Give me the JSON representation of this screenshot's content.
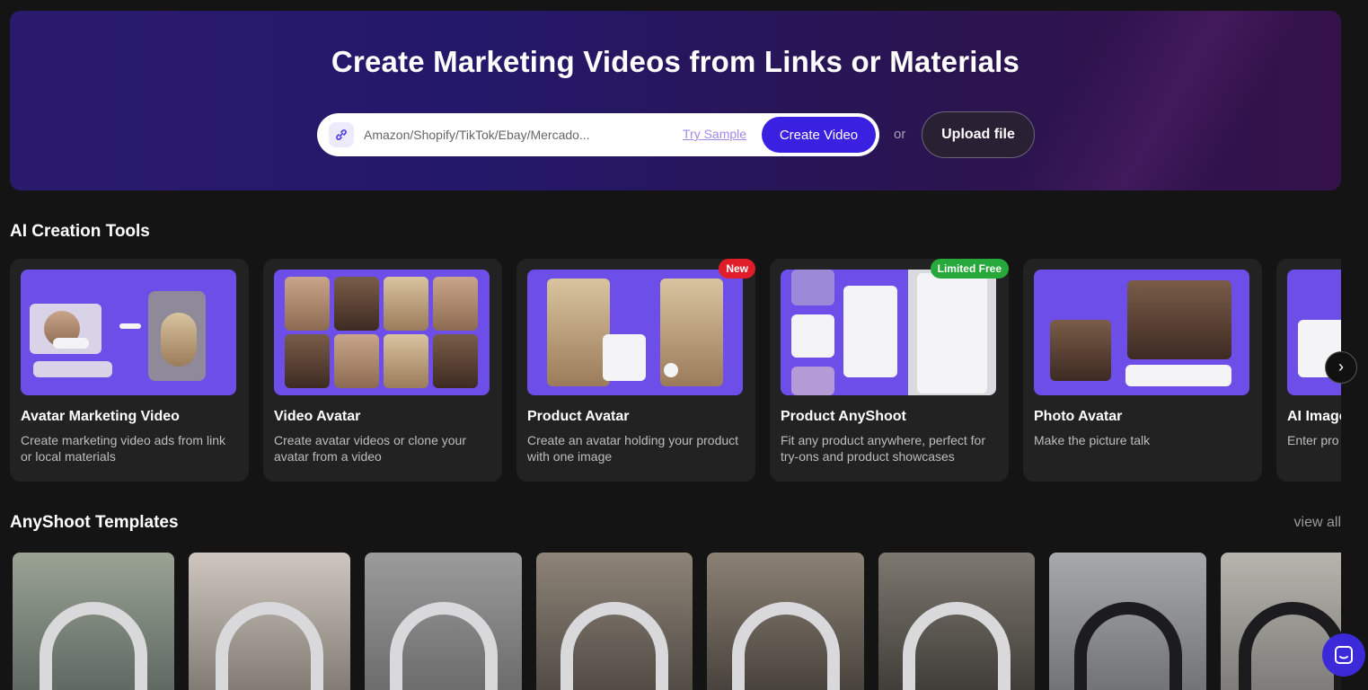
{
  "hero": {
    "title": "Create Marketing Videos from Links or Materials",
    "search_placeholder": "Amazon/Shopify/TikTok/Ebay/Mercado...",
    "try_sample": "Try Sample",
    "create_button": "Create Video",
    "or_label": "or",
    "upload_button": "Upload file",
    "link_icon": "link-icon"
  },
  "tools_section": {
    "title": "AI Creation Tools",
    "cards": [
      {
        "name": "Avatar Marketing Video",
        "desc": "Create marketing video ads from link or local materials",
        "badge": ""
      },
      {
        "name": "Video Avatar",
        "desc": "Create avatar videos or clone your avatar from a video",
        "badge": ""
      },
      {
        "name": "Product Avatar",
        "desc": "Create an avatar holding your product with one image",
        "badge": "New"
      },
      {
        "name": "Product AnyShoot",
        "desc": "Fit any product anywhere, perfect for try-ons and product showcases",
        "badge": "Limited Free"
      },
      {
        "name": "Photo Avatar",
        "desc": "Make the picture talk",
        "badge": ""
      },
      {
        "name": "AI Image",
        "desc": "Enter pro",
        "badge": ""
      }
    ],
    "next_icon": "chevron-right-icon"
  },
  "templates_section": {
    "title": "AnyShoot Templates",
    "view_all": "view all",
    "count": 8
  },
  "colors": {
    "accent": "#3a20e0",
    "badge_new": "#e21d2a",
    "badge_free": "#26a83a",
    "thumb_purple": "#6d4ee8"
  },
  "chat": {
    "icon": "chat-icon"
  }
}
